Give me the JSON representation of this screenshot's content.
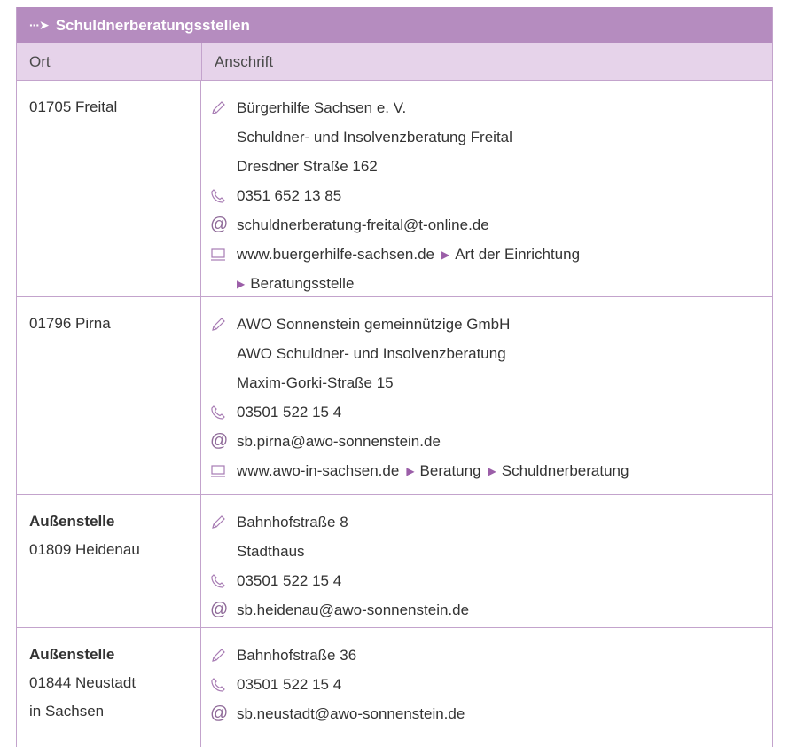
{
  "title": "Schuldnerberatungsstellen",
  "columns": {
    "ort": "Ort",
    "anschrift": "Anschrift"
  },
  "rows": [
    {
      "ort_prefix": "",
      "ort": "01705 Freital",
      "ort_extra": "",
      "name": "Bürgerhilfe Sachsen e. V.",
      "lines": [
        "Schuldner- und Insolvenzberatung Freital",
        "Dresdner Straße 162"
      ],
      "phone": "0351 652 13 85",
      "email": "schuldnerberatung-freital@t-online.de",
      "web": "www.buergerhilfe-sachsen.de",
      "web_path1": "Art der Einrichtung",
      "web_path2": "Beratungsstelle"
    },
    {
      "ort_prefix": "",
      "ort": "01796 Pirna",
      "ort_extra": "",
      "name": "AWO Sonnenstein gemeinnützige GmbH",
      "lines": [
        "AWO Schuldner- und Insolvenzberatung",
        "Maxim-Gorki-Straße 15"
      ],
      "phone": "03501 522 15 4",
      "email": "sb.pirna@awo-sonnenstein.de",
      "web": "www.awo-in-sachsen.de",
      "web_path1": "Beratung",
      "web_path2": "Schuldnerberatung"
    },
    {
      "ort_prefix": "Außenstelle",
      "ort": "01809 Heidenau",
      "ort_extra": "",
      "name": "Bahnhofstraße 8",
      "lines": [
        "Stadthaus"
      ],
      "phone": "03501 522 15 4",
      "email": "sb.heidenau@awo-sonnenstein.de"
    },
    {
      "ort_prefix": "Außenstelle",
      "ort": "01844 Neustadt",
      "ort_extra": "in Sachsen",
      "name": "Bahnhofstraße 36",
      "lines": [],
      "phone": "03501 522 15 4",
      "email": "sb.neustadt@awo-sonnenstein.de"
    }
  ],
  "colors": {
    "header": "#b58cbf",
    "subheader": "#e6d3ea",
    "border": "#c3a3cc",
    "accent": "#9b5ea8"
  },
  "icons": {
    "address": "pencil-icon",
    "phone": "phone-icon",
    "email": "at-sign-icon",
    "web": "monitor-icon",
    "title": "dotted-arrow-icon"
  }
}
